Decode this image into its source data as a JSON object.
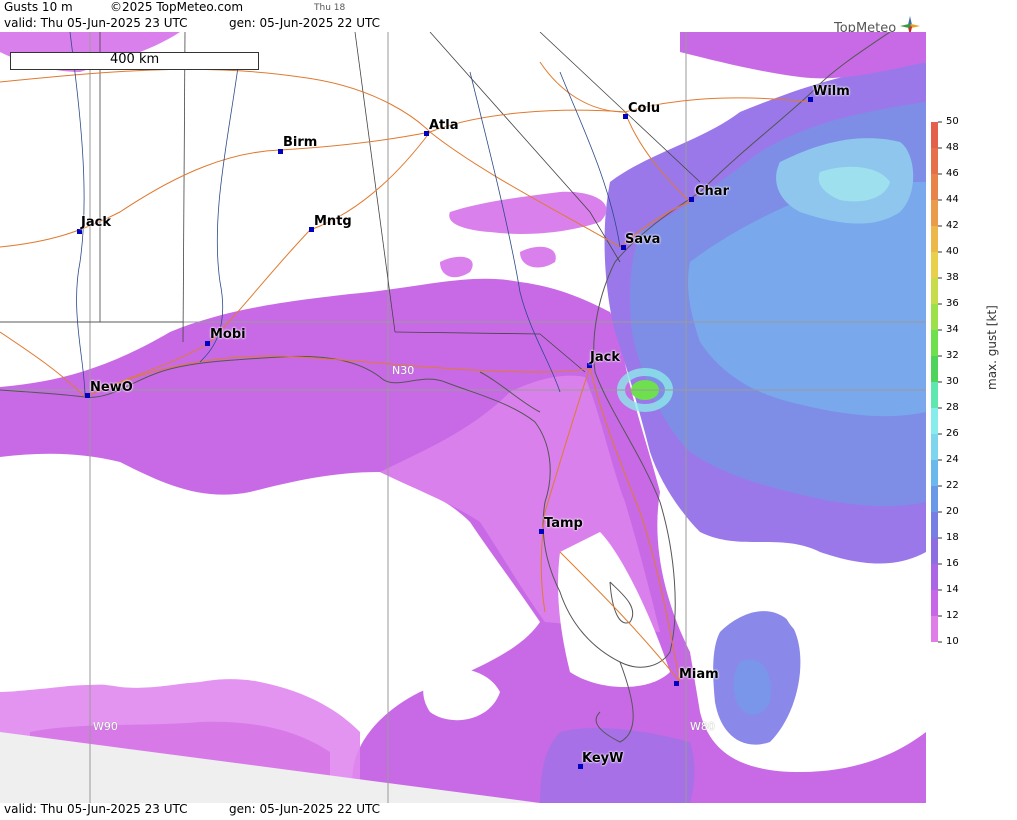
{
  "header": {
    "product": "Gusts 10 m",
    "copyright": "©2025 TopMeteo.com",
    "step": "Thu 18",
    "valid": "valid:  Thu  05-Jun-2025  23 UTC",
    "gen": "gen:  05-Jun-2025  22 UTC",
    "logo": "TopMeteo"
  },
  "footer": {
    "valid": "valid:  Thu  05-Jun-2025  23 UTC",
    "gen": "gen:  05-Jun-2025  22 UTC"
  },
  "scale": {
    "label": "400 km"
  },
  "cities": [
    {
      "name": "Wilm"
    },
    {
      "name": "Colu"
    },
    {
      "name": "Atla"
    },
    {
      "name": "Birm"
    },
    {
      "name": "Char"
    },
    {
      "name": "Jack"
    },
    {
      "name": "Mntg"
    },
    {
      "name": "Sava"
    },
    {
      "name": "Mobi"
    },
    {
      "name": "Jack"
    },
    {
      "name": "NewO"
    },
    {
      "name": "Tamp"
    },
    {
      "name": "Miam"
    },
    {
      "name": "KeyW"
    }
  ],
  "grid_labels": {
    "lat": "N30",
    "lon_w90": "W90",
    "lon_w80": "W80"
  },
  "legend": {
    "title": "max. gust [kt]",
    "ticks": [
      "50",
      "48",
      "46",
      "44",
      "42",
      "40",
      "38",
      "36",
      "34",
      "32",
      "30",
      "28",
      "26",
      "24",
      "22",
      "20",
      "18",
      "16",
      "14",
      "12",
      "10"
    ],
    "colors": [
      "#e4604a",
      "#e6704a",
      "#e8844a",
      "#ea9c4a",
      "#ecb84a",
      "#e8d04a",
      "#c8dc4a",
      "#9ce04a",
      "#6ee04e",
      "#4ed45a",
      "#5ee8b0",
      "#86ecec",
      "#7ed6ee",
      "#6ab8ec",
      "#6a98e8",
      "#767ee4",
      "#8c6ee0",
      "#aa66e4",
      "#c866e8",
      "#e07ee8"
    ]
  }
}
